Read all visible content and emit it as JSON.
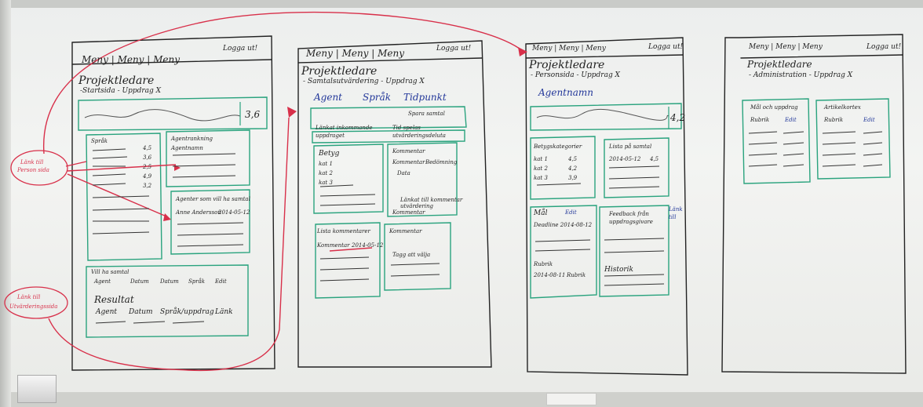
{
  "scene": {
    "description_free": true
  },
  "board1": {
    "menu": "Meny | Meny | Meny",
    "logout": "Logga ut!",
    "role": "Projektledare",
    "subtitle": "-Startsida - Uppdrag X",
    "score": "3,6",
    "sprak_title": "Språk",
    "sprak_values": [
      "4,5",
      "3,6",
      "2,5",
      "4,9",
      "3,2"
    ],
    "agent_title": "Agentrankning",
    "agent_row": "Agentnamn",
    "agenter_title": "Agenter som vill ha samtal",
    "agenter_row": "Anne Andersson",
    "agenter_date": "2014-05-12",
    "filter_title": "Vill ha samtal",
    "filters": [
      "Agent",
      "Datum",
      "Datum",
      "Språk",
      "Edit"
    ],
    "result_title": "Resultat",
    "result_cols": [
      "Agent",
      "Datum",
      "Språk/uppdrag",
      "Länk"
    ],
    "note_person": [
      "Länk till",
      "Person sida"
    ],
    "note_utvard": [
      "Länk till",
      "Utvärderingssida"
    ]
  },
  "board2": {
    "menu": "Meny | Meny | Meny",
    "logout": "Logga ut!",
    "role": "Projektledare",
    "subtitle": "- Samtalsutvärdering - Uppdrag X",
    "tabs": [
      "Agent",
      "Språk",
      "Tidpunkt"
    ],
    "player_label": "Spara samtal",
    "linkbox_left": [
      "Länkat inkommande",
      "uppdraget"
    ],
    "linkbox_right": [
      "Tid spelas",
      "utvärderingsdeluta"
    ],
    "betyg_title": "Betyg",
    "betyg_rows": [
      "kat 1",
      "kat 2",
      "kat 3"
    ],
    "kommentar_title": "Kommentar",
    "kommentar_tags": [
      "Kommentar",
      "Bedömning"
    ],
    "kommentar_text": "Data",
    "kommentar_note": [
      "Länkat till kommentar",
      "utvärdering"
    ],
    "kommentar_btn": "Kommentar",
    "lista_title": "Lista kommentarer",
    "lista_row": "Kommentar",
    "lista_date": "2014-05-12",
    "kommentar2_title": "Kommentar",
    "kommentar2_row": "Tagg att välja"
  },
  "board3": {
    "menu": "Meny | Meny | Meny",
    "logout": "Logga ut!",
    "role": "Projektledare",
    "subtitle": "- Personsida - Uppdrag X",
    "agent": "Agentnamn",
    "score": "4,2",
    "betyg_title": "Betygskategorier",
    "betyg_rows": [
      [
        "kat 1",
        "4,5"
      ],
      [
        "kat 2",
        "4,2"
      ],
      [
        "kat 3",
        "3,9"
      ]
    ],
    "lista_title": "Lista på samtal",
    "lista_row": [
      "2014-05-12",
      "4,5"
    ],
    "mal_title": "Mål",
    "mal_edit": "Edit",
    "deadline": "Deadline 2014-08-12",
    "feedback_title": [
      "Feedback från",
      "uppdragsgivare"
    ],
    "feedback_note": [
      "Länk",
      "till"
    ],
    "rubrik_title": "Rubrik",
    "rubrik_row": [
      "2014-08-11",
      "Rubrik"
    ],
    "historik_title": "Historik"
  },
  "board4": {
    "menu": "Meny | Meny | Meny",
    "logout": "Logga ut!",
    "role": "Projektledare",
    "subtitle": "- Administration - Uppdrag X",
    "left_title": "Mål och uppdrag",
    "left_cols": [
      "Rubrik",
      "Edit"
    ],
    "right_title": "Artikelkortex",
    "right_cols": [
      "Rubrik",
      "Edit"
    ]
  }
}
